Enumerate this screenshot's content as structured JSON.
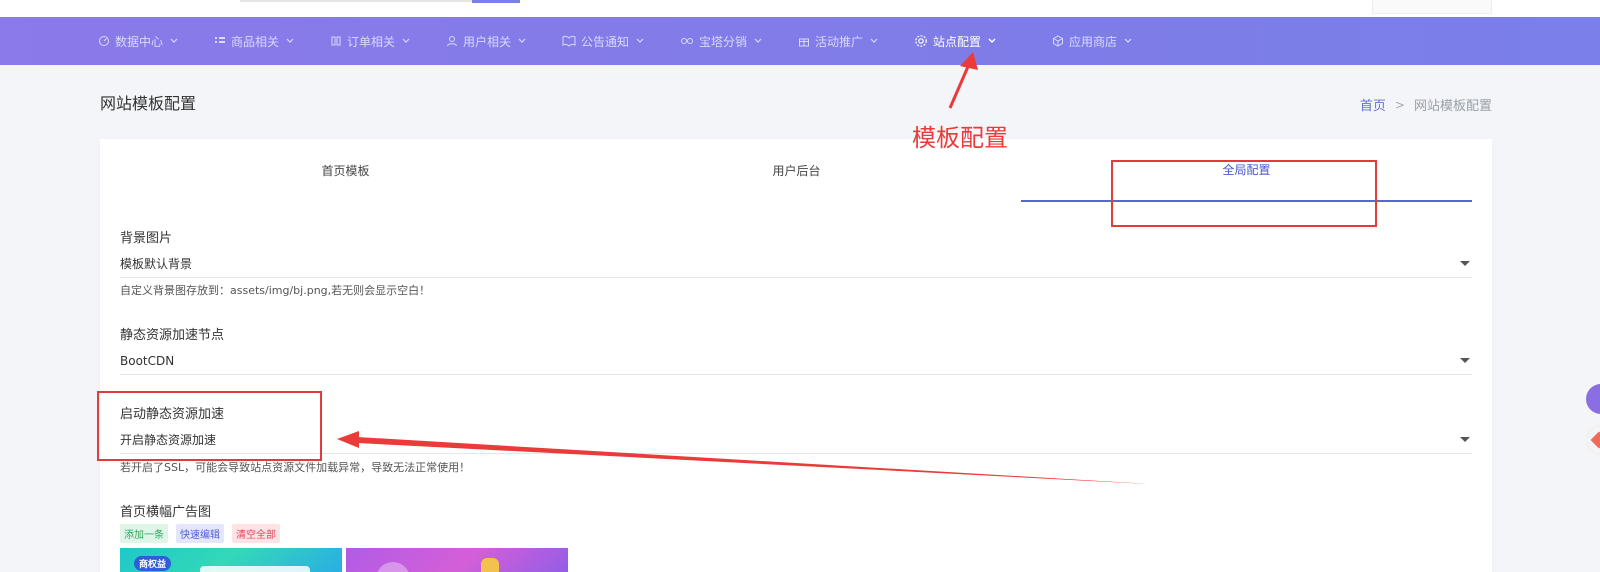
{
  "nav": {
    "items": [
      {
        "label": "数据中心",
        "icon": "dashboard-icon"
      },
      {
        "label": "商品相关",
        "icon": "grid-icon"
      },
      {
        "label": "订单相关",
        "icon": "order-icon"
      },
      {
        "label": "用户相关",
        "icon": "user-icon"
      },
      {
        "label": "公告通知",
        "icon": "book-icon"
      },
      {
        "label": "宝塔分销",
        "icon": "link-icon"
      },
      {
        "label": "活动推广",
        "icon": "gift-icon"
      },
      {
        "label": "站点配置",
        "icon": "gear-icon",
        "active": true
      },
      {
        "label": "应用商店",
        "icon": "cube-icon"
      }
    ]
  },
  "header": {
    "title": "网站模板配置",
    "breadcrumb": {
      "home": "首页",
      "separator": ">",
      "current": "网站模板配置"
    }
  },
  "tabs": [
    {
      "label": "首页模板",
      "active": false
    },
    {
      "label": "用户后台",
      "active": false
    },
    {
      "label": "全局配置",
      "active": true
    }
  ],
  "form": {
    "background": {
      "label": "背景图片",
      "value": "模板默认背景",
      "help": "自定义背景图存放到：assets/img/bj.png,若无则会显示空白！"
    },
    "cdn": {
      "label": "静态资源加速节点",
      "value": "BootCDN"
    },
    "accel": {
      "label": "启动静态资源加速",
      "value": "开启静态资源加速",
      "help": "若开启了SSL，可能会导致站点资源文件加载异常，导致无法正常使用！"
    },
    "banner": {
      "label": "首页横幅广告图",
      "actions": {
        "add": "添加一条",
        "edit": "快速编辑",
        "clear": "清空全部"
      },
      "images": [
        {
          "badge": "商权益"
        },
        {
          "badge": ""
        }
      ]
    }
  },
  "annotation": {
    "text": "模板配置",
    "color": "#ea3a3a"
  },
  "colors": {
    "nav_gradient_start": "#8b7ae9",
    "nav_gradient_end": "#7a7fe9",
    "accent": "#5865d6",
    "annotation_red": "#e23b3b"
  }
}
